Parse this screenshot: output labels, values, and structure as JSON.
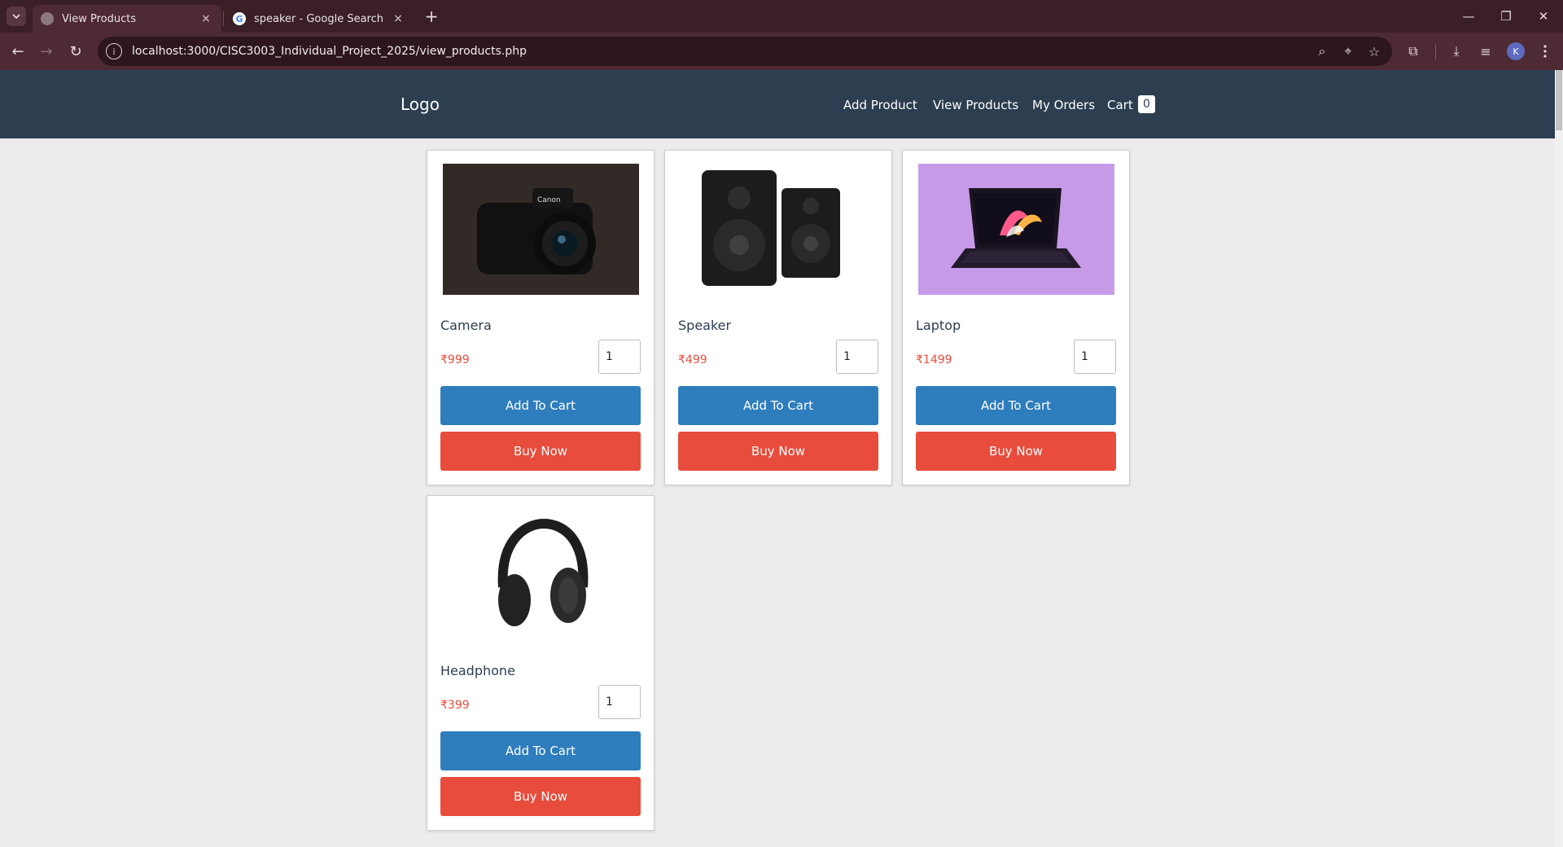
{
  "browser": {
    "tabs": [
      {
        "title": "View Products",
        "active": true
      },
      {
        "title": "speaker - Google Search",
        "active": false,
        "favicon_letter": "G"
      }
    ],
    "url": "localhost:3000/CISC3003_Individual_Project_2025/view_products.php",
    "profile_initial": "K",
    "icons": {
      "tab_search": "chevron-down",
      "close": "×",
      "new_tab": "+",
      "minimize": "—",
      "restore": "❐",
      "window_close": "✕",
      "back": "←",
      "forward": "→",
      "reload": "↻",
      "site_info": "i",
      "zoom": "⌕",
      "location": "⌖",
      "bookmark": "☆",
      "extensions": "⧉",
      "downloads": "⤓",
      "media": "≡"
    }
  },
  "site": {
    "logo": "Logo",
    "nav": [
      "Add Product",
      "View Products",
      "My Orders",
      "Cart"
    ],
    "cart_count": "0",
    "colors": {
      "header": "#2c3e50",
      "add_to_cart": "#2e7dbd",
      "buy_now": "#e74c3c",
      "price": "#e74c3c"
    }
  },
  "products": [
    {
      "name": "Camera",
      "price": "₹999",
      "qty": "1",
      "add_label": "Add To Cart",
      "buy_label": "Buy Now"
    },
    {
      "name": "Speaker",
      "price": "₹499",
      "qty": "1",
      "add_label": "Add To Cart",
      "buy_label": "Buy Now"
    },
    {
      "name": "Laptop",
      "price": "₹1499",
      "qty": "1",
      "add_label": "Add To Cart",
      "buy_label": "Buy Now"
    },
    {
      "name": "Headphone",
      "price": "₹399",
      "qty": "1",
      "add_label": "Add To Cart",
      "buy_label": "Buy Now"
    }
  ]
}
